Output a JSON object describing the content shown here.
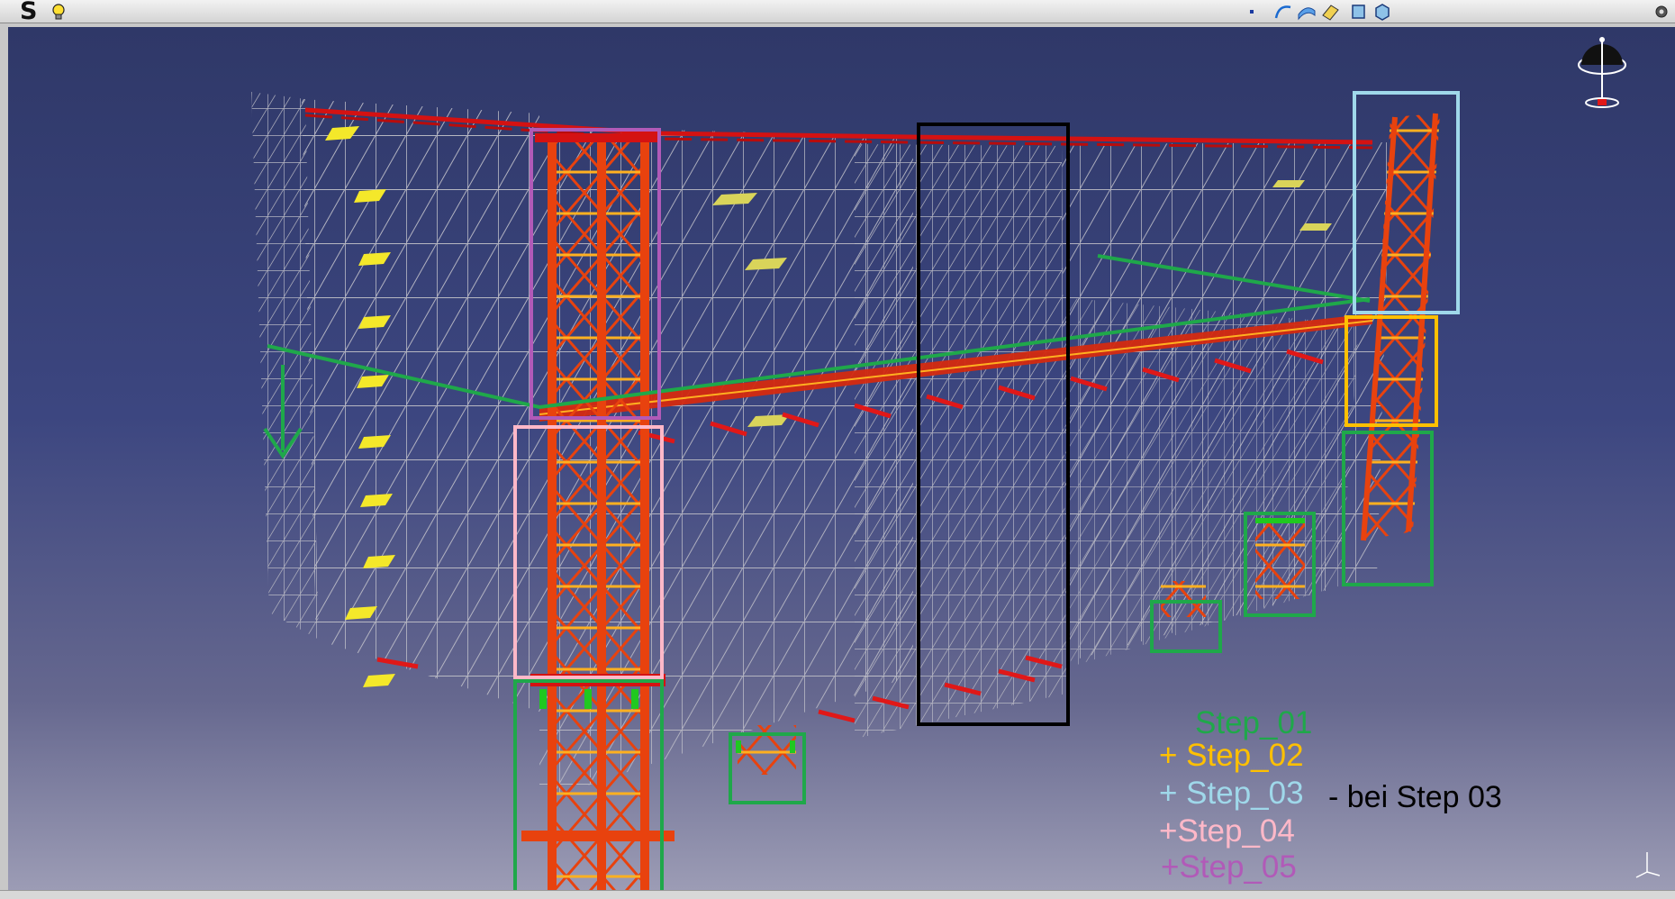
{
  "app": {
    "logo_text": "S",
    "tip_icon": "lightbulb-icon"
  },
  "toolbar": {
    "icons": [
      "point-icon",
      "curve-icon",
      "surface-icon",
      "sketch-icon",
      "view-front-icon",
      "view-iso-icon",
      "settings-icon"
    ]
  },
  "viewport": {
    "background_top": "#2f3868",
    "background_bottom": "#9c9cb5"
  },
  "legend": {
    "steps": [
      {
        "label": "Step_01",
        "color": "#1fa84a"
      },
      {
        "label": "+ Step_02",
        "color": "#ffc000"
      },
      {
        "label": "+ Step_03",
        "color": "#9fd8ea"
      },
      {
        "label": "+Step_04",
        "color": "#ffb8c8"
      },
      {
        "label": "+Step_05",
        "color": "#b15ab8"
      }
    ],
    "note": "- bei Step 03"
  },
  "markers": {
    "step_01_color": "#1fa84a",
    "step_02_color": "#ffc000",
    "step_03_color": "#9fd8ea",
    "step_04_color": "#ffb8c8",
    "step_05_color": "#b15ab8",
    "highlight_color": "#000000",
    "direction_arrow": "arrow-down-icon"
  }
}
